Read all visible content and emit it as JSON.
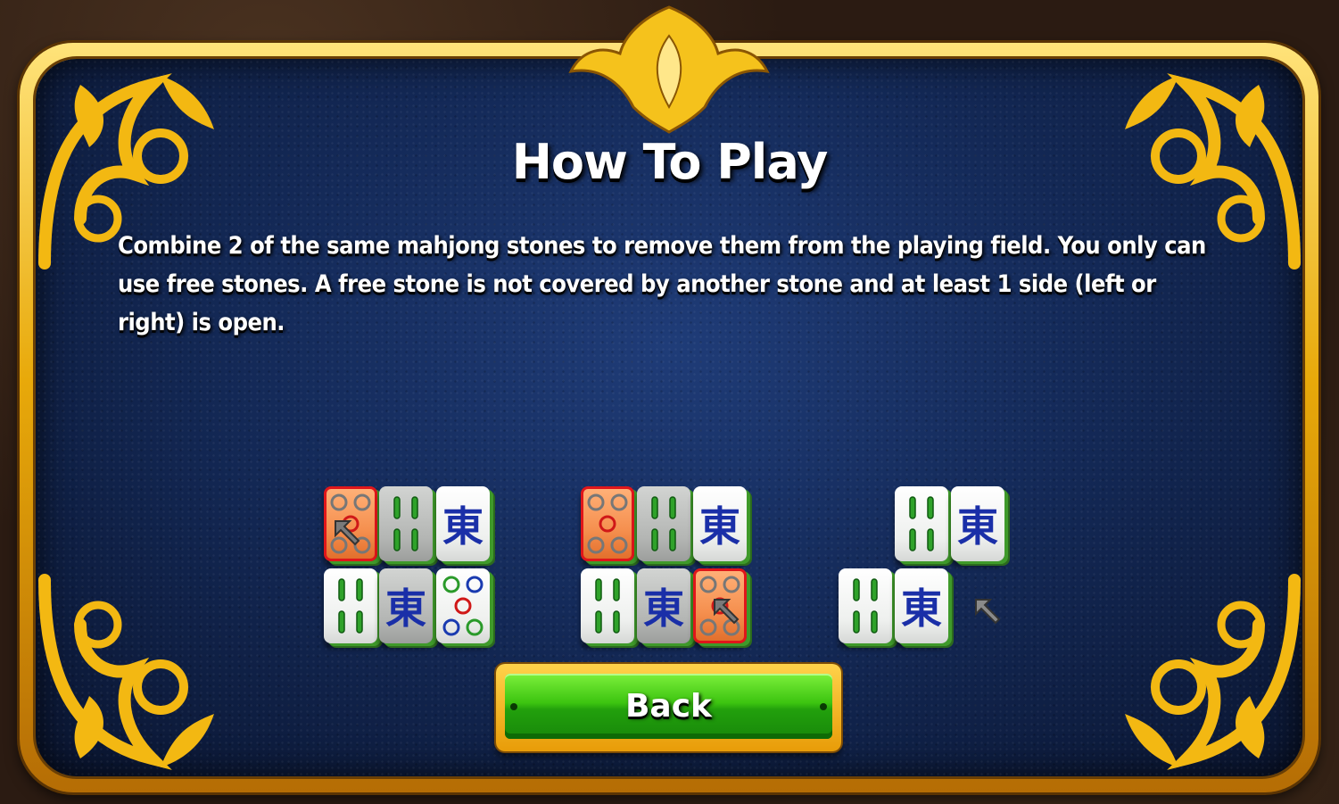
{
  "dialog": {
    "title": "How To Play",
    "description": "Combine 2 of the same mahjong stones to remove them from the playing field. You only can use free stones. A free stone is not covered by another stone and at least 1 side (left or right) is open."
  },
  "buttons": {
    "back_label": "Back"
  },
  "tiles": {
    "east_glyph": "東"
  },
  "colors": {
    "frame_gold": "#f0b416",
    "panel_blue": "#142a59",
    "button_green": "#3cc410",
    "selected_tile": "#f58f4e",
    "tile_edge_green": "#3f9a2a"
  }
}
